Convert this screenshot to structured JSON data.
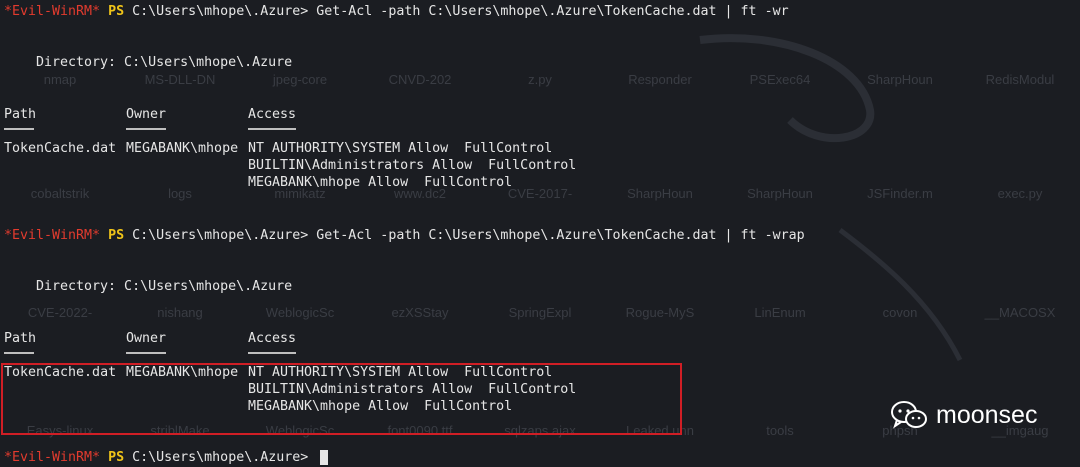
{
  "terminal": {
    "prompt_tag": "*Evil-WinRM*",
    "prompt_ps": "PS",
    "prompt_path": "C:\\Users\\mhope\\.Azure>",
    "command1": "Get-Acl -path C:\\Users\\mhope\\.Azure\\TokenCache.dat | ft -wr",
    "command2": "Get-Acl -path C:\\Users\\mhope\\.Azure\\TokenCache.dat | ft -wrap",
    "directory_line": "Directory: C:\\Users\\mhope\\.Azure",
    "headers": {
      "path": "Path",
      "owner": "Owner",
      "access": "Access"
    },
    "row": {
      "path": "TokenCache.dat",
      "owner": "MEGABANK\\mhope",
      "access": [
        "NT AUTHORITY\\SYSTEM Allow  FullControl",
        "BUILTIN\\Administrators Allow  FullControl",
        "MEGABANK\\mhope Allow  FullControl"
      ]
    }
  },
  "desktop_icons_row1": [
    "nmap",
    "MS-DLL-DN",
    "jpeg-core",
    "CNVD-202",
    "z.py",
    "Responder",
    "PSExec64",
    "SharpHoun",
    "RedisModul"
  ],
  "desktop_icons_row2": [
    "cobaltstrik",
    "logs",
    "mimikatz",
    "www.dc2",
    "CVE-2017-",
    "SharpHoun",
    "SharpHoun",
    "JSFinder.m",
    "exec.py"
  ],
  "desktop_icons_row3": [
    "CVE-2022-",
    "nishang",
    "WeblogicSc",
    "ezXSStay",
    "SpringExpl",
    "Rogue-MyS",
    "LinEnum",
    "covon",
    "__MACOSX"
  ],
  "desktop_icons_row4": [
    "Easys-linux",
    "striblMake",
    "WeblogicSc",
    "font0090.ttf",
    "sqlzaps.ajax",
    "Leaked.unn",
    "tools",
    "phpsh",
    "__imgaug"
  ],
  "watermark": {
    "text": "moonsec",
    "icon": "wechat-icon"
  },
  "colors": {
    "background": "#1b1d22",
    "prompt_red": "#e23b2e",
    "ps_yellow": "#f0c419",
    "text": "#e6e6e6",
    "highlight_border": "#d01e25"
  }
}
